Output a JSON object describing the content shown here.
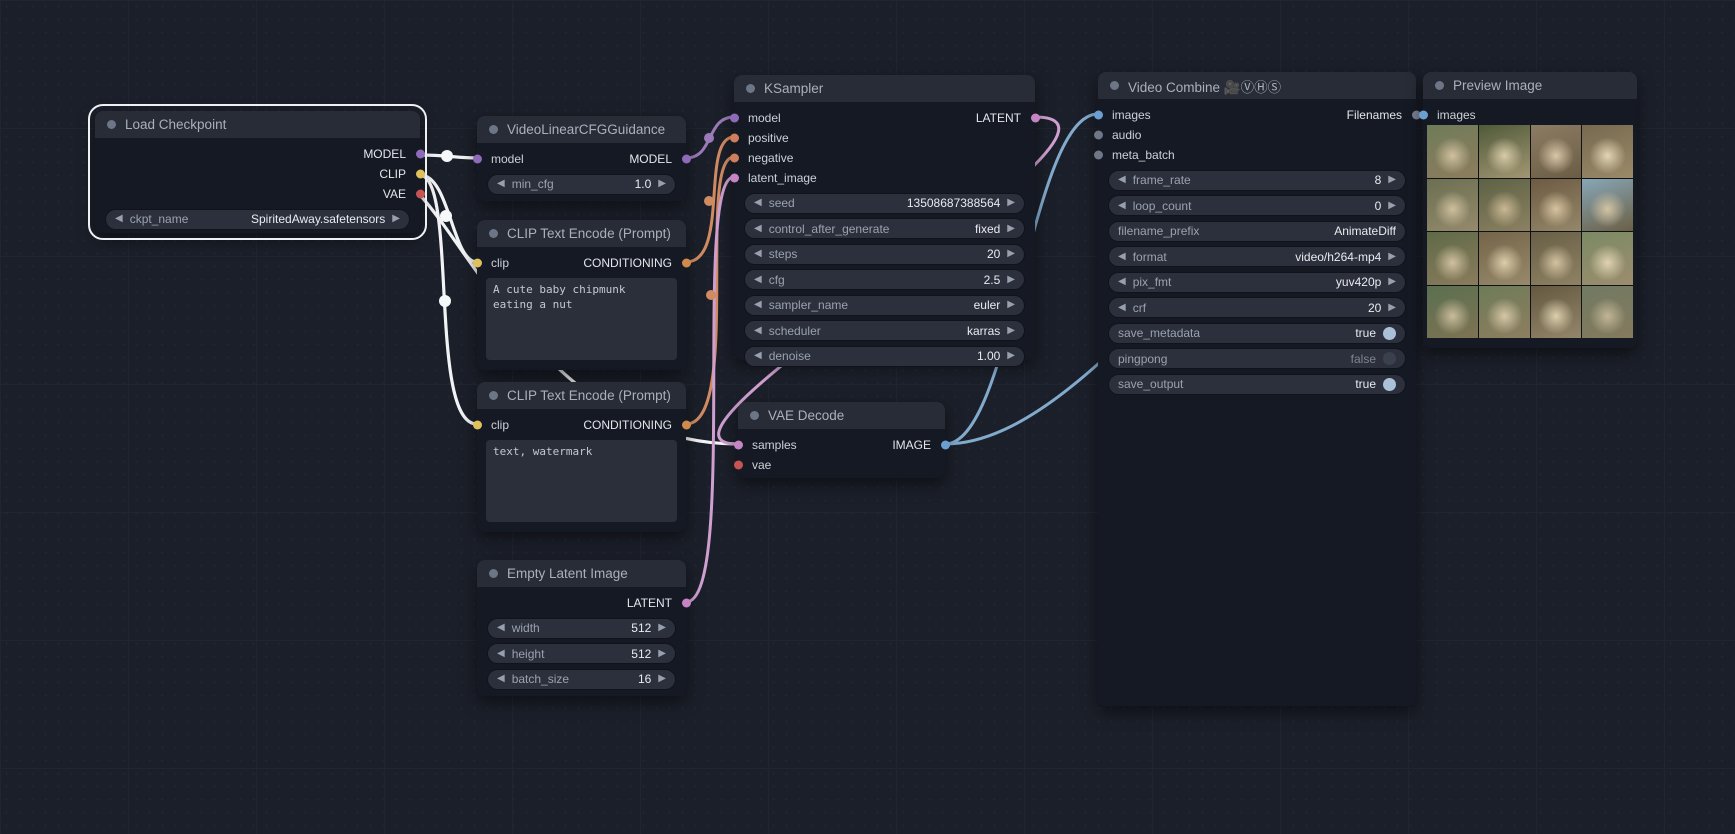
{
  "colors": {
    "link_white": "#f2f3f5",
    "link_model": "#9a7ab8",
    "link_conditioning": "#d08b62",
    "link_latent": "#cf9fd0",
    "link_image": "#82aacd",
    "slot_model": "#8d6bb8",
    "slot_clip": "#dfc05a",
    "slot_vae": "#c75454",
    "slot_conditioning": "#cf8a4e",
    "slot_latent": "#c585c5",
    "slot_image": "#6b9fd2",
    "slot_gray": "#6e7687"
  },
  "icons": {
    "left": "◀",
    "right": "▶"
  },
  "nodes": {
    "load_checkpoint": {
      "title": "Load Checkpoint",
      "outputs": {
        "model": "MODEL",
        "clip": "CLIP",
        "vae": "VAE"
      },
      "widgets": {
        "ckpt_name": {
          "label": "ckpt_name",
          "value": "SpiritedAway.safetensors"
        }
      }
    },
    "video_cfg": {
      "title": "VideoLinearCFGGuidance",
      "inputs": {
        "model": "model"
      },
      "outputs": {
        "model": "MODEL"
      },
      "widgets": {
        "min_cfg": {
          "label": "min_cfg",
          "value": "1.0"
        }
      }
    },
    "clip_positive": {
      "title": "CLIP Text Encode (Prompt)",
      "inputs": {
        "clip": "clip"
      },
      "outputs": {
        "conditioning": "CONDITIONING"
      },
      "text": "A cute baby chipmunk eating a nut"
    },
    "clip_negative": {
      "title": "CLIP Text Encode (Prompt)",
      "inputs": {
        "clip": "clip"
      },
      "outputs": {
        "conditioning": "CONDITIONING"
      },
      "text": "text, watermark"
    },
    "empty_latent": {
      "title": "Empty Latent Image",
      "outputs": {
        "latent": "LATENT"
      },
      "widgets": {
        "width": {
          "label": "width",
          "value": "512"
        },
        "height": {
          "label": "height",
          "value": "512"
        },
        "batch_size": {
          "label": "batch_size",
          "value": "16"
        }
      }
    },
    "ksampler": {
      "title": "KSampler",
      "inputs": {
        "model": "model",
        "positive": "positive",
        "negative": "negative",
        "latent_image": "latent_image"
      },
      "outputs": {
        "latent": "LATENT"
      },
      "widgets": {
        "seed": {
          "label": "seed",
          "value": "13508687388564"
        },
        "control_after_generate": {
          "label": "control_after_generate",
          "value": "fixed"
        },
        "steps": {
          "label": "steps",
          "value": "20"
        },
        "cfg": {
          "label": "cfg",
          "value": "2.5"
        },
        "sampler_name": {
          "label": "sampler_name",
          "value": "euler"
        },
        "scheduler": {
          "label": "scheduler",
          "value": "karras"
        },
        "denoise": {
          "label": "denoise",
          "value": "1.00"
        }
      }
    },
    "vae_decode": {
      "title": "VAE Decode",
      "inputs": {
        "samples": "samples",
        "vae": "vae"
      },
      "outputs": {
        "image": "IMAGE"
      }
    },
    "video_combine": {
      "title": "Video Combine 🎥ⓋⒽⓈ",
      "inputs": {
        "images": "images",
        "audio": "audio",
        "meta_batch": "meta_batch"
      },
      "outputs": {
        "filenames": "Filenames"
      },
      "widgets": {
        "frame_rate": {
          "label": "frame_rate",
          "value": "8"
        },
        "loop_count": {
          "label": "loop_count",
          "value": "0"
        },
        "filename_prefix": {
          "label": "filename_prefix",
          "value": "AnimateDiff"
        },
        "format": {
          "label": "format",
          "value": "video/h264-mp4"
        },
        "pix_fmt": {
          "label": "pix_fmt",
          "value": "yuv420p"
        },
        "crf": {
          "label": "crf",
          "value": "20"
        },
        "save_metadata": {
          "label": "save_metadata",
          "value": "true",
          "on": true
        },
        "pingpong": {
          "label": "pingpong",
          "value": "false",
          "on": false
        },
        "save_output": {
          "label": "save_output",
          "value": "true",
          "on": true
        }
      }
    },
    "preview_image": {
      "title": "Preview Image",
      "inputs": {
        "images": "images"
      }
    }
  },
  "preview_frames": [
    [
      "#6f7b58",
      "#8d7d5e",
      "#cfc0a0"
    ],
    [
      "#4f5a38",
      "#a39674",
      "#d8cba9"
    ],
    [
      "#8c7c63",
      "#6b5d45",
      "#d9c6a7"
    ],
    [
      "#77694f",
      "#9a8a69",
      "#e2d4b4"
    ],
    [
      "#6b6f52",
      "#958a6b",
      "#cdbf9e"
    ],
    [
      "#5d6244",
      "#8c8162",
      "#c9b893"
    ],
    [
      "#6d5b41",
      "#95876a",
      "#d6c3a0"
    ],
    [
      "#87a7b8",
      "#6b5f44",
      "#d3c4a3"
    ],
    [
      "#5f6a47",
      "#8a7c5d",
      "#d0c1a0"
    ],
    [
      "#74654a",
      "#97896a",
      "#dccdab"
    ],
    [
      "#685f46",
      "#8f8263",
      "#d2c2a1"
    ],
    [
      "#7b8a64",
      "#9c8d6e",
      "#e0d2b2"
    ],
    [
      "#5a7050",
      "#7e7354",
      "#c9bc9c"
    ],
    [
      "#6e7b57",
      "#8d7e60",
      "#d5c7a6"
    ],
    [
      "#64583f",
      "#93866a",
      "#dbcfae"
    ],
    [
      "#707a62",
      "#857a5e",
      "#c2b596"
    ]
  ]
}
